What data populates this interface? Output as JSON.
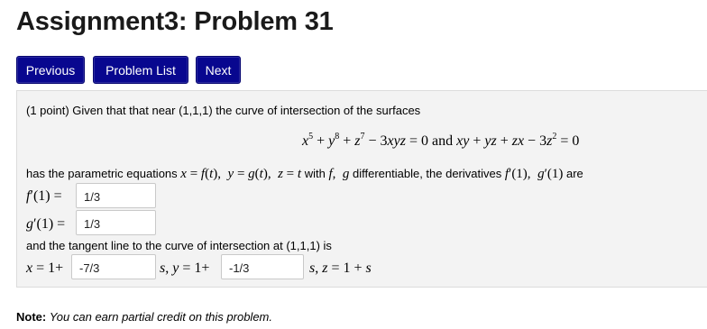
{
  "page": {
    "title": "Assignment3: Problem 31"
  },
  "nav": {
    "previous_label": "Previous",
    "problem_list_label": "Problem List",
    "next_label": "Next"
  },
  "problem": {
    "intro": "(1 point) Given that that near (1,1,1) the curve of intersection of the surfaces",
    "and_word": "and",
    "param_prefix": "has the parametric equations",
    "with_word": "with",
    "differentiable_text": "differentiable, the derivatives",
    "are_word": "are",
    "tangent_text": "and the tangent line to the curve of intersection at (1,1,1) is"
  },
  "answers": {
    "f_prime_value": "1/3",
    "g_prime_value": "1/3",
    "x_coeff_value": "-7/3",
    "y_coeff_value": "-1/3"
  },
  "note": {
    "label": "Note:",
    "text": "You can earn partial credit on this problem."
  }
}
